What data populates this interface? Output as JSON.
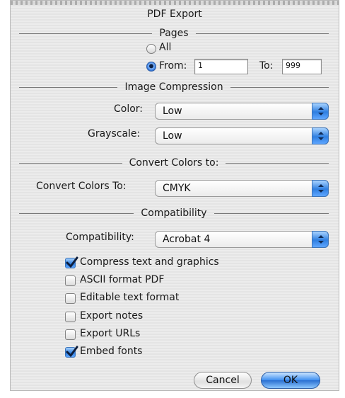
{
  "dialog": {
    "title": "PDF Export"
  },
  "pages": {
    "heading": "Pages",
    "all_label": "All",
    "from_label": "From:",
    "from_value": "1",
    "to_label": "To:",
    "to_value": "999",
    "selected": "from"
  },
  "image_compression": {
    "heading": "Image Compression",
    "color_label": "Color:",
    "color_value": "Low",
    "grayscale_label": "Grayscale:",
    "grayscale_value": "Low"
  },
  "convert_colors": {
    "heading": "Convert Colors to:",
    "label": "Convert Colors To:",
    "value": "CMYK"
  },
  "compatibility": {
    "heading": "Compatibility",
    "label": "Compatibility:",
    "value": "Acrobat 4"
  },
  "options": [
    {
      "label": "Compress text and graphics",
      "checked": true
    },
    {
      "label": "ASCII format PDF",
      "checked": false
    },
    {
      "label": "Editable text format",
      "checked": false
    },
    {
      "label": "Export notes",
      "checked": false
    },
    {
      "label": "Export URLs",
      "checked": false
    },
    {
      "label": "Embed fonts",
      "checked": true
    }
  ],
  "buttons": {
    "cancel": "Cancel",
    "ok": "OK"
  },
  "colors": {
    "accent": "#2f7fe0",
    "background": "#ececec"
  }
}
